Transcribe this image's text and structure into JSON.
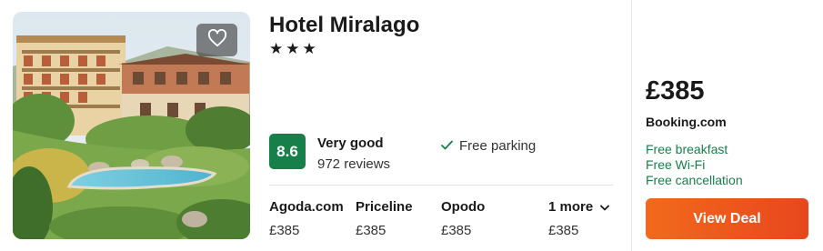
{
  "hotel": {
    "name": "Hotel Miralago",
    "stars_text": "★★★",
    "star_count": 3
  },
  "rating": {
    "score": "8.6",
    "label": "Very good",
    "reviews": "972 reviews"
  },
  "amenity": "Free parking",
  "providers": [
    {
      "name": "Agoda.com",
      "price": "£385"
    },
    {
      "name": "Priceline",
      "price": "£385"
    },
    {
      "name": "Opodo",
      "price": "£385"
    },
    {
      "name": "1 more",
      "price": "£385"
    }
  ],
  "deal": {
    "price": "£385",
    "site": "Booking.com",
    "perks": [
      "Free breakfast",
      "Free Wi-Fi",
      "Free cancellation"
    ],
    "button_label": "View Deal"
  },
  "icons": {
    "favorite": "heart-icon",
    "amenity": "check-icon",
    "more": "chevron-down-icon"
  },
  "colors": {
    "rating_bg": "#17804a",
    "perks": "#17804a",
    "deal_button": "#f26a1b"
  }
}
